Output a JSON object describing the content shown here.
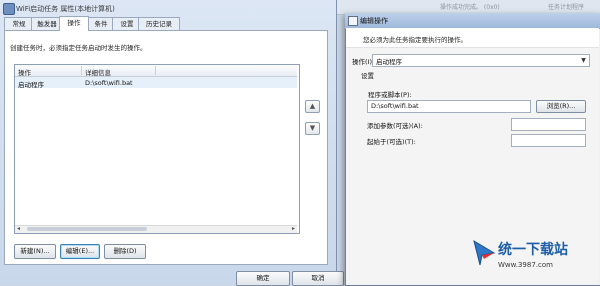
{
  "background_window": {
    "status_fragments": [
      "...",
      "操作成功完成。 (0x0)",
      "任务计划程序"
    ]
  },
  "properties_window": {
    "title": "WiFi启动任务 属性(本地计算机)",
    "tabs": [
      "常规",
      "触发器",
      "操作",
      "条件",
      "设置",
      "历史记录"
    ],
    "active_tab": "操作",
    "description": "创建任务时，必须指定任务启动时发生的操作。",
    "list": {
      "columns": [
        "操作",
        "详细信息"
      ],
      "rows": [
        {
          "action": "启动程序",
          "details": "D:\\soft\\wifi.bat"
        }
      ]
    },
    "move_up": "▲",
    "move_down": "▼",
    "buttons": {
      "new": "新建(N)...",
      "edit": "编辑(E)...",
      "delete": "删除(D)",
      "ok": "确定",
      "cancel": "取消"
    }
  },
  "edit_dialog": {
    "title": "编辑操作",
    "description": "您必须为此任务指定要执行的操作。",
    "action_label": "操作(I):",
    "action_value": "启动程序",
    "settings_label": "设置",
    "program_label": "程序或脚本(P):",
    "program_value": "D:\\soft\\wifi.bat",
    "browse_button": "浏览(R)...",
    "args_label": "添加参数(可选)(A):",
    "args_value": "",
    "startin_label": "起始于(可选)(T):",
    "startin_value": ""
  },
  "watermark": {
    "title": "统一下载站",
    "url": "Www.3987.com"
  },
  "colors": {
    "accent": "#1e5ea8",
    "selected_row": "#e5f0fb",
    "titlebar": "#9fb8da"
  }
}
